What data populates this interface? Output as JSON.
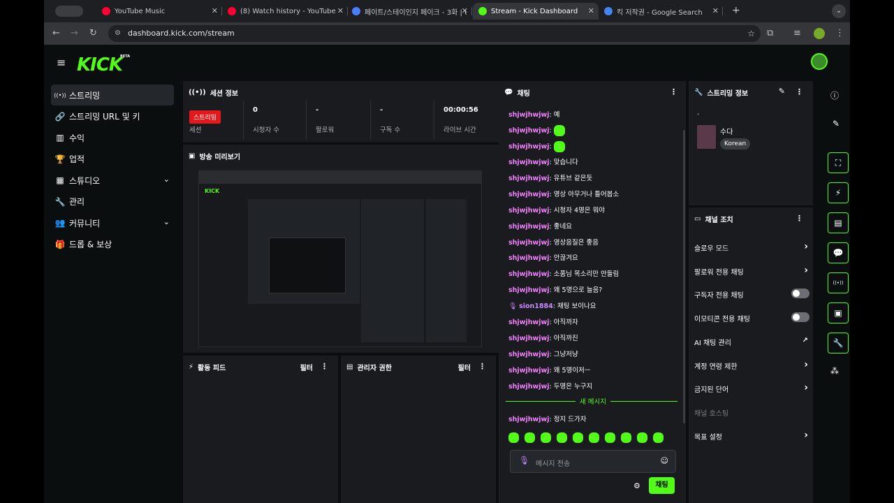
{
  "browser": {
    "tabs": [
      {
        "title": "YouTube Music",
        "color": "#ff0033"
      },
      {
        "title": "(8) Watch history - YouTube",
        "color": "#ff0033"
      },
      {
        "title": "페이트/스테이인지 페이크 - 3화 | U",
        "color": "#4a7fff"
      },
      {
        "title": "Stream - Kick Dashboard",
        "color": "#53fc18"
      },
      {
        "title": "킥 저작권 - Google Search",
        "color": "#4285f4"
      }
    ],
    "url": "dashboard.kick.com/stream"
  },
  "brand": {
    "logo": "KICK",
    "beta": "BETA",
    "accent": "#53fc18"
  },
  "sidebar": {
    "items": [
      {
        "label": "스트리밍",
        "icon": "broadcast-icon"
      },
      {
        "label": "스트리밍 URL 및 키",
        "icon": "link-icon"
      },
      {
        "label": "수익",
        "icon": "chart-icon"
      },
      {
        "label": "업적",
        "icon": "trophy-icon"
      },
      {
        "label": "스튜디오",
        "icon": "studio-icon"
      },
      {
        "label": "관리",
        "icon": "wrench-icon"
      },
      {
        "label": "커뮤니티",
        "icon": "people-icon"
      },
      {
        "label": "드롭 & 보상",
        "icon": "gift-icon"
      }
    ]
  },
  "session": {
    "title": "세션 정보",
    "live_badge": "스트리밍",
    "session_label": "세션",
    "stats": [
      {
        "value": "0",
        "label": "시청자 수"
      },
      {
        "value": "-",
        "label": "팔로워"
      },
      {
        "value": "-",
        "label": "구독 수"
      },
      {
        "value": "00:00:56",
        "label": "라이브 시간"
      }
    ]
  },
  "preview": {
    "title": "방송 미리보기"
  },
  "activity": {
    "title": "활동 피드",
    "filter": "필터"
  },
  "mod": {
    "title": "관리자 권한",
    "filter": "필터"
  },
  "chat": {
    "title": "채팅",
    "messages": [
      {
        "user": "shjwjhwjwj",
        "text": "예"
      },
      {
        "user": "shjwjhwjwj",
        "text": "",
        "emote": true
      },
      {
        "user": "shjwjhwjwj",
        "text": "",
        "emote": true
      },
      {
        "user": "shjwjhwjwj",
        "text": "맞습니다"
      },
      {
        "user": "shjwjhwjwj",
        "text": "유튜브 같은듯"
      },
      {
        "user": "shjwjhwjwj",
        "text": "영상 아무거나 틀어봅소"
      },
      {
        "user": "shjwjhwjwj",
        "text": "시청자 4명은 뭐야"
      },
      {
        "user": "shjwjhwjwj",
        "text": "좋네요"
      },
      {
        "user": "shjwjhwjwj",
        "text": "영상음질은 좋음"
      },
      {
        "user": "shjwjhwjwj",
        "text": "안끊겨요"
      },
      {
        "user": "shjwjhwjwj",
        "text": "소품님 목소리만 안들림"
      },
      {
        "user": "shjwjhwjwj",
        "text": "왜 5명으로 늘음?"
      },
      {
        "user": "sion1884",
        "text": "채팅 보이나요",
        "mic": true
      },
      {
        "user": "shjwjhwjwj",
        "text": "아직까자"
      },
      {
        "user": "shjwjhwjwj",
        "text": "아직까진"
      },
      {
        "user": "shjwjhwjwj",
        "text": "그냥저냥"
      },
      {
        "user": "shjwjhwjwj",
        "text": "왜 5명이저ㅡ"
      },
      {
        "user": "shjwjhwjwj",
        "text": "두명은 누구지"
      }
    ],
    "new_msg_divider": "새 메시지",
    "last": {
      "user": "shjwjhwjwj",
      "text": "정지 드가자"
    },
    "placeholder": "메시지 전송",
    "send": "채팅"
  },
  "stream_info": {
    "title": "스트리밍 정보",
    "dot": ".",
    "category": "수다",
    "tag": "Korean"
  },
  "channel": {
    "title": "채널 조치",
    "rows": [
      {
        "label": "슬로우 모드",
        "kind": "chev"
      },
      {
        "label": "팔로워 전용 채팅",
        "kind": "chev"
      },
      {
        "label": "구독자 전용 채팅",
        "kind": "toggle"
      },
      {
        "label": "이모티콘 전용 채팅",
        "kind": "toggle"
      },
      {
        "label": "AI 채팅 관리",
        "kind": "ext"
      },
      {
        "label": "계정 연령 제한",
        "kind": "chev"
      },
      {
        "label": "금지된 단어",
        "kind": "chev"
      },
      {
        "label": "채널 호스팅",
        "kind": "dim"
      },
      {
        "label": "목표 설정",
        "kind": "chev"
      }
    ]
  }
}
